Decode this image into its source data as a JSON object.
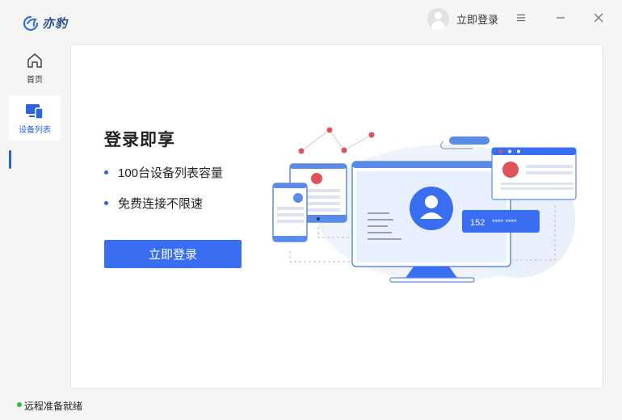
{
  "app": {
    "name": "亦豹",
    "login_link": "立即登录"
  },
  "sidebar": {
    "items": [
      {
        "label": "首页",
        "icon": "home-icon",
        "active": false
      },
      {
        "label": "设备列表",
        "icon": "device-list-icon",
        "active": true
      }
    ]
  },
  "main": {
    "headline": "登录即享",
    "features": [
      "100台设备列表容量",
      "免费连接不限速"
    ],
    "login_button": "立即登录",
    "illustration": {
      "card_number": "152",
      "card_masked": "**** ****"
    }
  },
  "status": {
    "text": "远程准备就绪",
    "color": "#2ec13a"
  },
  "colors": {
    "accent": "#3a6ef2",
    "active_nav": "#2a64e0"
  }
}
